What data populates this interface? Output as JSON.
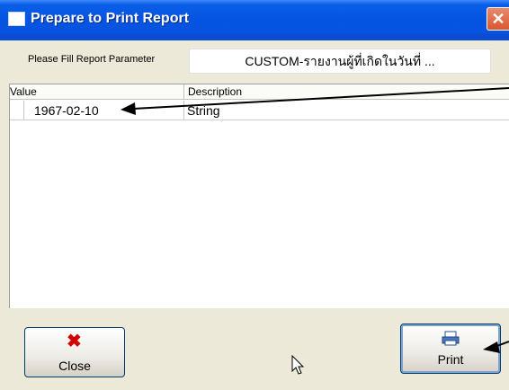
{
  "window": {
    "title": "Prepare to Print Report",
    "close_glyph": "✕"
  },
  "parameter": {
    "label": "Please Fill Report Parameter",
    "value": "CUSTOM-รายงานผู้ที่เกิดในวันที่ ..."
  },
  "table": {
    "columns": [
      "Value",
      "Description"
    ],
    "rows": [
      {
        "value": "1967-02-10",
        "description": "String"
      }
    ]
  },
  "buttons": {
    "close": {
      "label": "Close",
      "icon": "close-x-icon"
    },
    "print": {
      "label": "Print",
      "icon": "printer-icon"
    }
  },
  "colors": {
    "titlebar": "#0554e2",
    "body": "#ece9d8",
    "close_icon": "#d40000",
    "annotation_arrow": "#000000"
  }
}
